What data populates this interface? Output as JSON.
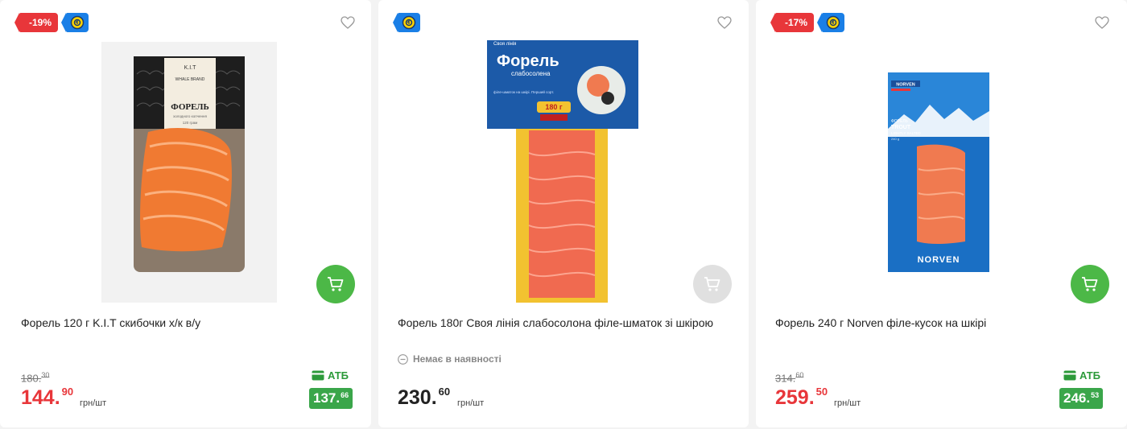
{
  "colors": {
    "discount": "#e8363a",
    "promo": "#1a7fe6",
    "cart_active": "#4cb847",
    "cart_disabled": "#e0e0e0",
    "atb_green": "#3aa64a"
  },
  "products": [
    {
      "discount_badge": "-19%",
      "promo_icon": "coin-promo-icon",
      "title": "Форель 120 г K.I.T скибочки х/к в/у",
      "old_price": {
        "int": "180.",
        "cents": "30"
      },
      "price": {
        "int": "144.",
        "cents": "90"
      },
      "unit": "грн/шт",
      "card_label": "АТБ",
      "card_price": {
        "int": "137.",
        "cents": "66"
      },
      "package": {
        "brand": "K.I.T",
        "brand_sub": "WHALE BRAND",
        "name": "ФОРЕЛЬ",
        "desc": "холодного копчення",
        "weight": "120 грам"
      },
      "in_cart_enabled": true
    },
    {
      "promo_icon": "coin-promo-icon",
      "title": "Форель 180г Своя лінія слабосолона філе-шматок зі шкірою",
      "stock_status": "Немає в наявності",
      "price": {
        "int": "230.",
        "cents": "60"
      },
      "unit": "грн/шт",
      "package": {
        "brand": "Своя лінія",
        "name": "Форель",
        "sub": "слабосолена",
        "weight": "180 г",
        "tagline": "філе-шматок на шкірі. Перший сорт."
      },
      "in_cart_enabled": false
    },
    {
      "discount_badge": "-17%",
      "promo_icon": "coin-promo-icon",
      "title": "Форель 240 г Norven філе-кусок на шкірі",
      "old_price": {
        "int": "314.",
        "cents": "60"
      },
      "price": {
        "int": "259.",
        "cents": "50"
      },
      "unit": "грн/шт",
      "card_label": "АТБ",
      "card_price": {
        "int": "246.",
        "cents": "53"
      },
      "package": {
        "brand": "NORVEN",
        "name_ua": "ФОРЕЛЬ",
        "name_en": "TROUT",
        "sub_en": "LIGHTLY SALTED",
        "weight": "240 g"
      },
      "in_cart_enabled": true
    }
  ]
}
